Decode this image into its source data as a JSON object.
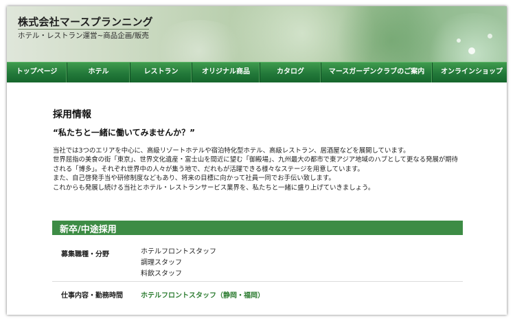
{
  "header": {
    "site_title": "株式会社マースプランニング",
    "site_subtitle": "ホテル・レストラン運営~商品企画/販売"
  },
  "nav": {
    "items": [
      {
        "label": "トップページ"
      },
      {
        "label": "ホテル"
      },
      {
        "label": "レストラン"
      },
      {
        "label": "オリジナル商品"
      },
      {
        "label": "カタログ"
      },
      {
        "label": "マースガーデンクラブのご案内"
      },
      {
        "label": "オンラインショップ"
      }
    ]
  },
  "main": {
    "page_title": "採用情報",
    "catch_copy": "“私たちと一緒に働いてみませんか？”",
    "intro_lines": [
      "当社では3つのエリアを中心に、高級リゾートホテルや宿泊特化型ホテル、高級レストラン、居酒屋などを展開しています。",
      "世界屈指の美食の街「東京」、世界文化遺産・富士山を間近に望む「御殿場」、九州最大の都市で東アジア地域のハブとして更なる発展が期待",
      "される「博多」。それぞれ世界中の人々が集う地で、だれもが活躍できる様々なステージを用意しています。",
      "また、自己啓発手当や研修制度などもあり、将来の目標に向かって社員一同でお手伝い致します。",
      "これからも発展し続ける当社とホテル・レストランサービス業界を、私たちと一緒に盛り上げていきましょう。"
    ],
    "section_title": "新卒/中途採用",
    "rows": [
      {
        "label": "募集職種・分野",
        "values": [
          "ホテルフロントスタッフ",
          "調理スタッフ",
          "料飲スタッフ"
        ]
      },
      {
        "label": "仕事内容・勤務時間",
        "link": "ホテルフロントスタッフ（静岡・福岡）"
      }
    ]
  },
  "colors": {
    "nav_green": "#23793a",
    "section_green": "#3d8c45",
    "link_green": "#2e7d32"
  }
}
